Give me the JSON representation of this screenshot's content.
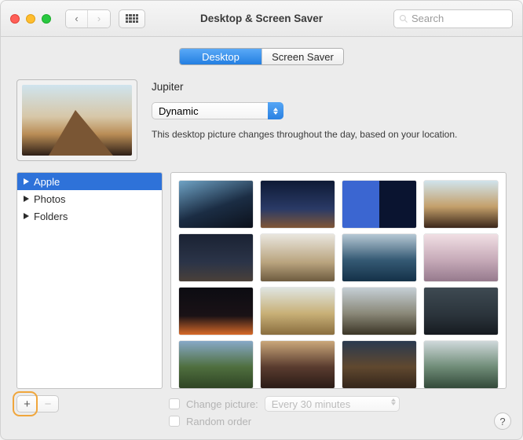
{
  "window": {
    "title": "Desktop & Screen Saver"
  },
  "search": {
    "placeholder": "Search"
  },
  "tabs": {
    "desktop": "Desktop",
    "screensaver": "Screen Saver"
  },
  "wallpaper": {
    "name": "Jupiter",
    "mode": "Dynamic",
    "hint": "This desktop picture changes throughout the day, based on your location."
  },
  "sidebar": {
    "items": [
      {
        "label": "Apple",
        "selected": true
      },
      {
        "label": "Photos",
        "selected": false
      },
      {
        "label": "Folders",
        "selected": false
      }
    ]
  },
  "thumb_colors": [
    "linear-gradient(160deg,#6fa3c5 0%,#1b2d44 55%,#0c111b 100%)",
    "linear-gradient(180deg,#0e1a35 0%,#2a3a66 60%,#805636 100%)",
    "linear-gradient(90deg,#3b66d1 0%,#3b66d1 50%,#0a1430 50%,#0a1430 100%)",
    "linear-gradient(180deg,#d0e3ec 0%,#c4a06b 55%,#3a2619 100%)",
    "linear-gradient(180deg,#1a2233 0%,#2b3448 60%,#4a4039 100%)",
    "linear-gradient(180deg,#e9e6de 0%,#b9a47e 60%,#6e5b3f 100%)",
    "linear-gradient(180deg,#b6c8d4 0%,#355a74 55%,#143148 100%)",
    "linear-gradient(180deg,#f1dfe4 0%,#c6aab8 55%,#967a8d 100%)",
    "linear-gradient(180deg,#0c0c12 0%,#1a1216 60%,#d86a28 100%)",
    "linear-gradient(180deg,#dfe5e1 0%,#c8b077 55%,#8a6e3f 100%)",
    "linear-gradient(180deg,#c5cfd6 0%,#8a8878 55%,#3b3526 100%)",
    "linear-gradient(180deg,#3e4a52 0%,#2a333a 60%,#161b20 100%)",
    "linear-gradient(180deg,#87a8c7 0%,#4f6f3f 55%,#2f4424 100%)",
    "linear-gradient(180deg,#caa77a 0%,#5a3c2f 55%,#2a1b16 100%)",
    "linear-gradient(180deg,#2a3a50 0%,#60482f 55%,#34261a 100%)",
    "linear-gradient(180deg,#cfd8da 0%,#6f8c77 55%,#33493a 100%)"
  ],
  "footer": {
    "add": "+",
    "remove": "−",
    "change_label": "Change picture:",
    "interval": "Every 30 minutes",
    "random_label": "Random order",
    "help": "?"
  }
}
